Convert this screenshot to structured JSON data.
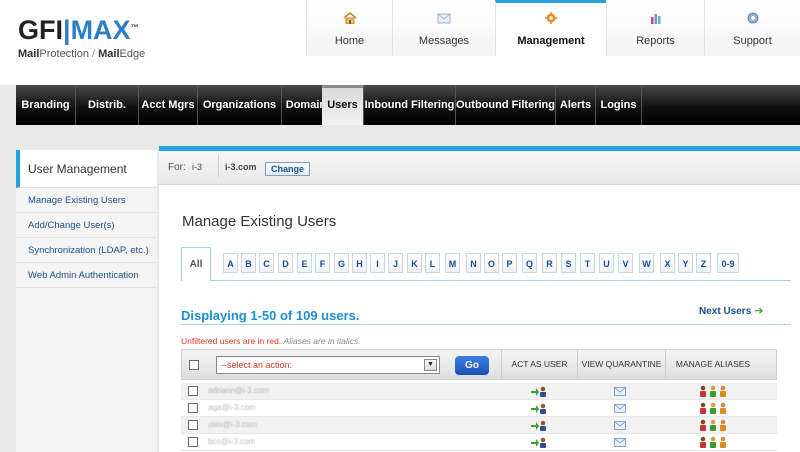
{
  "logo": {
    "brand_part1": "GFI",
    "brand_part2": "MAX",
    "trademark": "™",
    "sub_strong1": "Mail",
    "sub_light1": "Protection",
    "sub_sep": " / ",
    "sub_strong2": "Mail",
    "sub_light2": "Edge"
  },
  "topnav": [
    {
      "label": "Home",
      "icon": "home-icon"
    },
    {
      "label": "Messages",
      "icon": "envelope-icon"
    },
    {
      "label": "Management",
      "icon": "gear-icon",
      "active": true
    },
    {
      "label": "Reports",
      "icon": "bar-chart-icon"
    },
    {
      "label": "Support",
      "icon": "support-icon"
    }
  ],
  "mainnav": [
    "Branding",
    "Distrib.",
    "Acct Mgrs",
    "Organizations",
    "Domains",
    "Users",
    "Inbound Filtering",
    "Outbound Filtering",
    "Alerts",
    "Logins"
  ],
  "sidebar": {
    "title": "User Management",
    "items": [
      "Manage Existing Users",
      "Add/Change User(s)",
      "Synchronization (LDAP, etc.)",
      "Web Admin Authentication"
    ]
  },
  "forbar": {
    "label": "For:",
    "distributor": "i-3",
    "organization": "i-3.com",
    "change_label": "Change"
  },
  "page_title": "Manage Existing Users",
  "alpha": {
    "all_label": "All",
    "letters": [
      "A",
      "B",
      "C",
      "D",
      "E",
      "F",
      "G",
      "H",
      "I",
      "J",
      "K",
      "L",
      "M",
      "N",
      "O",
      "P",
      "Q",
      "R",
      "S",
      "T",
      "U",
      "V",
      "W",
      "X",
      "Y",
      "Z",
      "0-9"
    ]
  },
  "display_count": "Displaying 1-50 of 109 users.",
  "next_users": "Next Users",
  "legend_red": "Unfiltered users are in red.",
  "legend_italic": "Aliases are in italics.",
  "table": {
    "select_placeholder": "--select an action:",
    "go_label": "Go",
    "columns": [
      "ACT AS USER",
      "VIEW QUARANTINE",
      "MANAGE ALIASES"
    ],
    "rows": [
      {
        "email": "adriann@i-3.com"
      },
      {
        "email": "aga@i-3.com"
      },
      {
        "email": "alex@i-3.com"
      },
      {
        "email": "bco@i-3.com"
      }
    ]
  },
  "colors": {
    "accent_blue": "#29a0dc",
    "link_blue": "#1d4e8a",
    "count_blue": "#1e8fd0",
    "unfiltered_red": "#d9362f"
  }
}
